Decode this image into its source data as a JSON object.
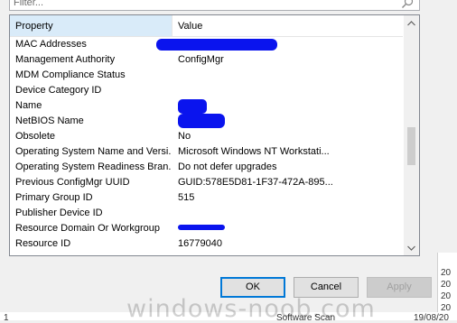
{
  "filter": {
    "placeholder": "Filter..."
  },
  "grid": {
    "columns": {
      "property": "Property",
      "value": "Value"
    },
    "rows": [
      {
        "property": "MAC Addresses",
        "value": ""
      },
      {
        "property": "Management Authority",
        "value": "ConfigMgr"
      },
      {
        "property": "MDM Compliance Status",
        "value": ""
      },
      {
        "property": "Device Category ID",
        "value": ""
      },
      {
        "property": "Name",
        "value": ""
      },
      {
        "property": "NetBIOS Name",
        "value": ""
      },
      {
        "property": "Obsolete",
        "value": "No"
      },
      {
        "property": "Operating System Name and Versi...",
        "value": "Microsoft Windows NT Workstati..."
      },
      {
        "property": "Operating System Readiness Bran...",
        "value": "Do not defer upgrades"
      },
      {
        "property": "Previous ConfigMgr UUID",
        "value": "GUID:578E5D81-1F37-472A-895..."
      },
      {
        "property": "Primary Group ID",
        "value": "515"
      },
      {
        "property": "Publisher Device ID",
        "value": ""
      },
      {
        "property": "Resource Domain Or Workgroup",
        "value": ""
      },
      {
        "property": "Resource ID",
        "value": "16779040"
      }
    ]
  },
  "buttons": {
    "ok": "OK",
    "cancel": "Cancel",
    "apply": "Apply"
  },
  "background": {
    "right_numbers": [
      "20",
      "20",
      "20",
      "20"
    ],
    "bottom_left": "1",
    "bottom_middle": "Software Scan",
    "bottom_right": "19/08/20"
  },
  "watermark": "windows-noob.com",
  "colors": {
    "redaction": "#0a14ee",
    "header_highlight": "#d9ebf9",
    "ok_border": "#0078d7"
  }
}
